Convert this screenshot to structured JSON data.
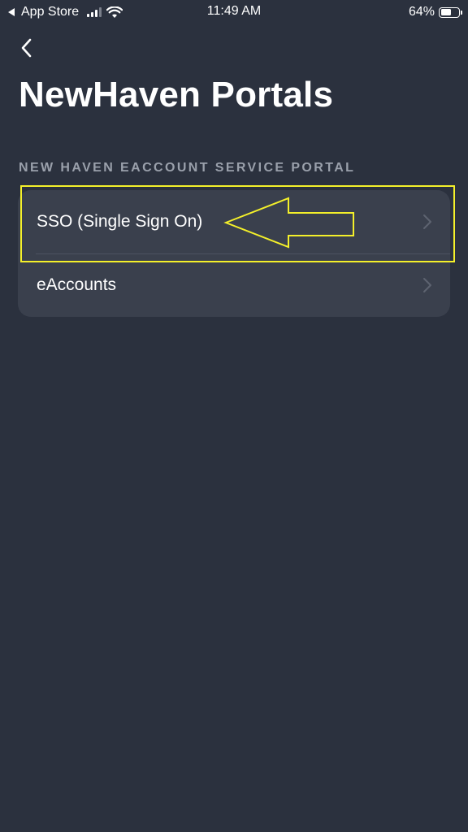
{
  "status_bar": {
    "back_app": "App Store",
    "time": "11:49 AM",
    "battery_percent_text": "64%",
    "battery_level": 0.64
  },
  "nav": {
    "back_icon": "chevron-left-icon"
  },
  "page": {
    "title": "NewHaven Portals"
  },
  "section": {
    "header": "NEW HAVEN EACCOUNT SERVICE PORTAL",
    "items": [
      {
        "label": "SSO (Single Sign On)",
        "icon": "chevron-right-icon"
      },
      {
        "label": "eAccounts",
        "icon": "chevron-right-icon"
      }
    ]
  },
  "colors": {
    "background": "#2b313e",
    "card": "#3a404d",
    "section_header": "#9aa0ab",
    "annotation": "#f4f02a"
  }
}
